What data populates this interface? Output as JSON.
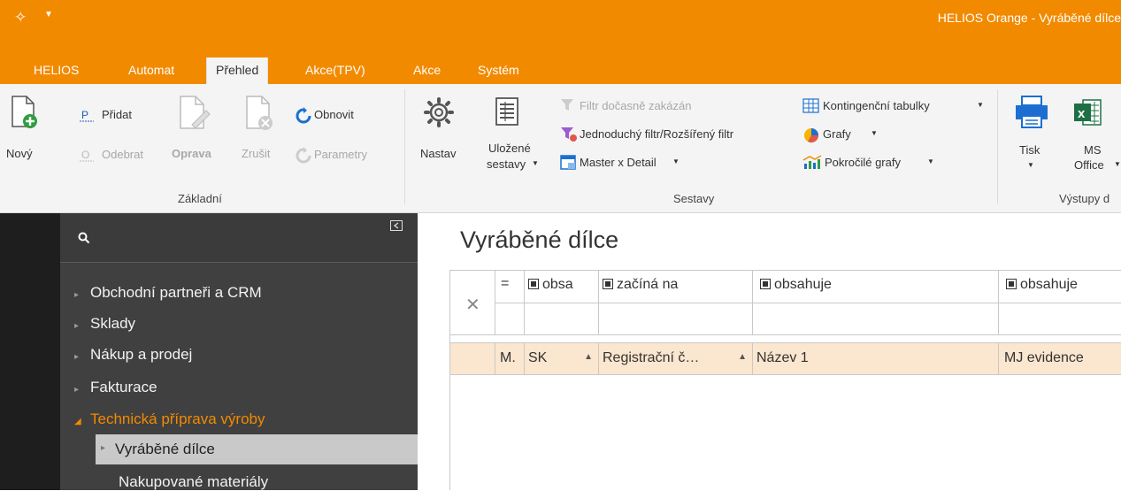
{
  "window": {
    "title": "HELIOS Orange - Vyráběné dílce"
  },
  "tabs": [
    {
      "label": "HELIOS"
    },
    {
      "label": "Automat"
    },
    {
      "label": "Přehled"
    },
    {
      "label": "Akce(TPV)"
    },
    {
      "label": "Akce"
    },
    {
      "label": "Systém"
    }
  ],
  "ribbon": {
    "zakladni": {
      "label": "Základní",
      "novy": "Nový",
      "pridat": "Přidat",
      "odebrat": "Odebrat",
      "oprava": "Oprava",
      "zrusit": "Zrušit",
      "obnovit": "Obnovit",
      "parametry": "Parametry"
    },
    "sestavy": {
      "label": "Sestavy",
      "nastav": "Nastav",
      "ulozene_1": "Uložené",
      "ulozene_2": "sestavy",
      "filtr_docasne": "Filtr dočasně zakázán",
      "jednoduchy_filtr": "Jednoduchý filtr/Rozšířený filtr",
      "master_detail": "Master x Detail",
      "kontingencni": "Kontingenční tabulky",
      "grafy": "Grafy",
      "pokrocile_grafy": "Pokročilé grafy"
    },
    "vystupy": {
      "label": "Výstupy d",
      "tisk": "Tisk",
      "ms_1": "MS",
      "ms_2": "Office"
    }
  },
  "nav": {
    "items": [
      {
        "label": "Obchodní partneři a CRM"
      },
      {
        "label": "Sklady"
      },
      {
        "label": "Nákup a prodej"
      },
      {
        "label": "Fakturace"
      },
      {
        "label": "Technická příprava výroby"
      },
      {
        "label": "Vyráběné dílce"
      },
      {
        "label": "Nakupované materiály"
      }
    ]
  },
  "main": {
    "title": "Vyráběné dílce",
    "filter_row": {
      "eq": "=",
      "c1": "obsa",
      "c2": "začíná na",
      "c3": "obsahuje",
      "c4": "obsahuje"
    },
    "columns": {
      "m": "M.",
      "sk": "SK",
      "reg": "Registrační č…",
      "nazev": "Název 1",
      "mj": "MJ evidence"
    }
  },
  "colors": {
    "accent": "#f28a00",
    "nav_bg": "#404040",
    "header_bg": "#fbe6cf"
  }
}
